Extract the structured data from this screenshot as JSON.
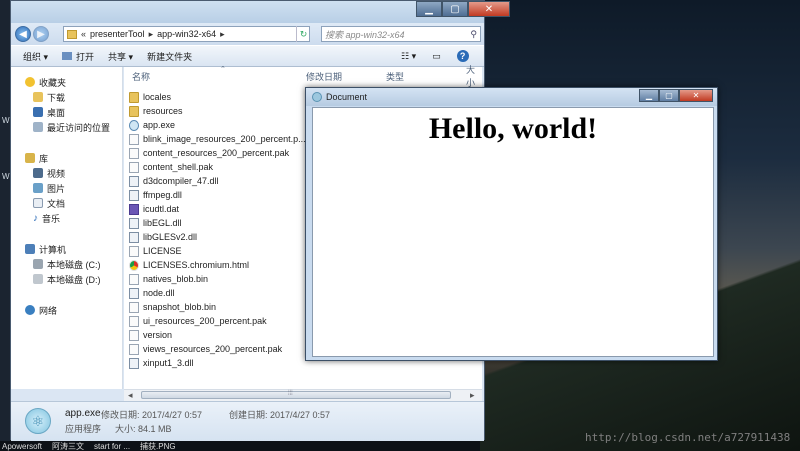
{
  "explorer": {
    "address": {
      "overflow": "«",
      "crumbs": [
        "presenterTool",
        "app-win32-x64"
      ]
    },
    "search_placeholder": "搜索 app-win32-x64",
    "toolbar": [
      "组织 ▾",
      "打开",
      "共享 ▾",
      "新建文件夹"
    ],
    "sidebar": {
      "favorites": {
        "label": "收藏夹",
        "items": [
          "下载",
          "桌面",
          "最近访问的位置"
        ]
      },
      "libraries": {
        "label": "库",
        "items": [
          "视频",
          "图片",
          "文档",
          "音乐"
        ]
      },
      "computer": {
        "label": "计算机",
        "items": [
          "本地磁盘 (C:)",
          "本地磁盘 (D:)"
        ]
      },
      "network": {
        "label": "网络"
      }
    },
    "columns": [
      "名称",
      "修改日期",
      "类型",
      "大小"
    ],
    "files": [
      {
        "name": "locales",
        "type": "folder"
      },
      {
        "name": "resources",
        "type": "folder"
      },
      {
        "name": "app.exe",
        "type": "exe"
      },
      {
        "name": "blink_image_resources_200_percent.p...",
        "type": "file"
      },
      {
        "name": "content_resources_200_percent.pak",
        "type": "file"
      },
      {
        "name": "content_shell.pak",
        "type": "file"
      },
      {
        "name": "d3dcompiler_47.dll",
        "type": "dll"
      },
      {
        "name": "ffmpeg.dll",
        "type": "dll"
      },
      {
        "name": "icudtl.dat",
        "type": "dat"
      },
      {
        "name": "libEGL.dll",
        "type": "dll"
      },
      {
        "name": "libGLESv2.dll",
        "type": "dll"
      },
      {
        "name": "LICENSE",
        "type": "file"
      },
      {
        "name": "LICENSES.chromium.html",
        "type": "chrome"
      },
      {
        "name": "natives_blob.bin",
        "type": "file"
      },
      {
        "name": "node.dll",
        "type": "dll"
      },
      {
        "name": "snapshot_blob.bin",
        "type": "file"
      },
      {
        "name": "ui_resources_200_percent.pak",
        "type": "file"
      },
      {
        "name": "version",
        "type": "file"
      },
      {
        "name": "views_resources_200_percent.pak",
        "type": "file"
      },
      {
        "name": "xinput1_3.dll",
        "type": "dll"
      }
    ],
    "scroll_arrow_left": "◂",
    "scroll_grip": "⦙⦙⦙",
    "scroll_arrow_right": "▸",
    "details": {
      "name": "app.exe",
      "modified_label": "修改日期: 2017/4/27 0:57",
      "created_label": "创建日期: 2017/4/27 0:57",
      "type": "应用程序",
      "size_label": "大小: 84.1 MB"
    }
  },
  "document": {
    "title": "Document",
    "heading": "Hello, world!"
  },
  "taskbar": [
    "Apowersoft",
    "阿涛三文",
    "start for ...",
    "捕获.PNG"
  ],
  "watermark": "http://blog.csdn.net/a727911438",
  "colors": {
    "explorer_frame": "#dbe6f3",
    "window_border": "#4a5b70",
    "close_button": "#c13a22"
  }
}
